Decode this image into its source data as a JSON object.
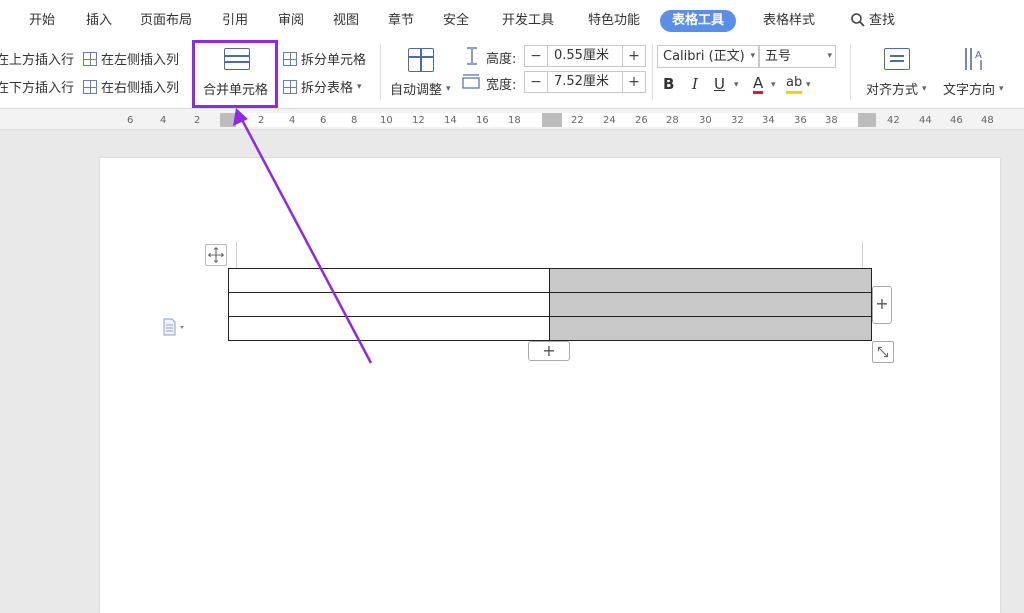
{
  "tabs": [
    {
      "label": "开始",
      "active": false
    },
    {
      "label": "插入",
      "active": false
    },
    {
      "label": "页面布局",
      "active": false
    },
    {
      "label": "引用",
      "active": false
    },
    {
      "label": "审阅",
      "active": false
    },
    {
      "label": "视图",
      "active": false
    },
    {
      "label": "章节",
      "active": false
    },
    {
      "label": "安全",
      "active": false
    },
    {
      "label": "开发工具",
      "active": false
    },
    {
      "label": "特色功能",
      "active": false
    },
    {
      "label": "表格工具",
      "active": true
    },
    {
      "label": "表格样式",
      "active": false
    }
  ],
  "search": {
    "label": "查找",
    "icon": "magnifier-icon"
  },
  "ribbon": {
    "insert_above": "在上方插入行",
    "insert_below": "在下方插入行",
    "insert_left": "在左侧插入列",
    "insert_right": "在右侧插入列",
    "merge_cells": "合并单元格",
    "split_cells": "拆分单元格",
    "split_table": "拆分表格",
    "auto_fit": "自动调整",
    "height_label": "高度:",
    "height_value": "0.55厘米",
    "width_label": "宽度:",
    "width_value": "7.52厘米",
    "font_name": "Calibri (正文)",
    "font_size": "五号",
    "bold": "B",
    "italic": "I",
    "underline": "U",
    "font_color": "A",
    "highlight": "ab",
    "alignment": "对齐方式",
    "text_direction": "文字方向"
  },
  "ruler": {
    "ticks": [
      "6",
      "4",
      "2",
      "2",
      "4",
      "6",
      "8",
      "10",
      "12",
      "14",
      "16",
      "18",
      "22",
      "24",
      "26",
      "28",
      "30",
      "32",
      "34",
      "36",
      "38",
      "42",
      "44",
      "46",
      "48"
    ]
  },
  "table": {
    "rows": 3,
    "cols": 2,
    "selected_col": 1
  },
  "colors": {
    "active_tab": "#5b8ee6",
    "highlight_box": "#8e2be2",
    "selected_cell": "#c8c8c8",
    "icon_blue": "#506aa6"
  }
}
